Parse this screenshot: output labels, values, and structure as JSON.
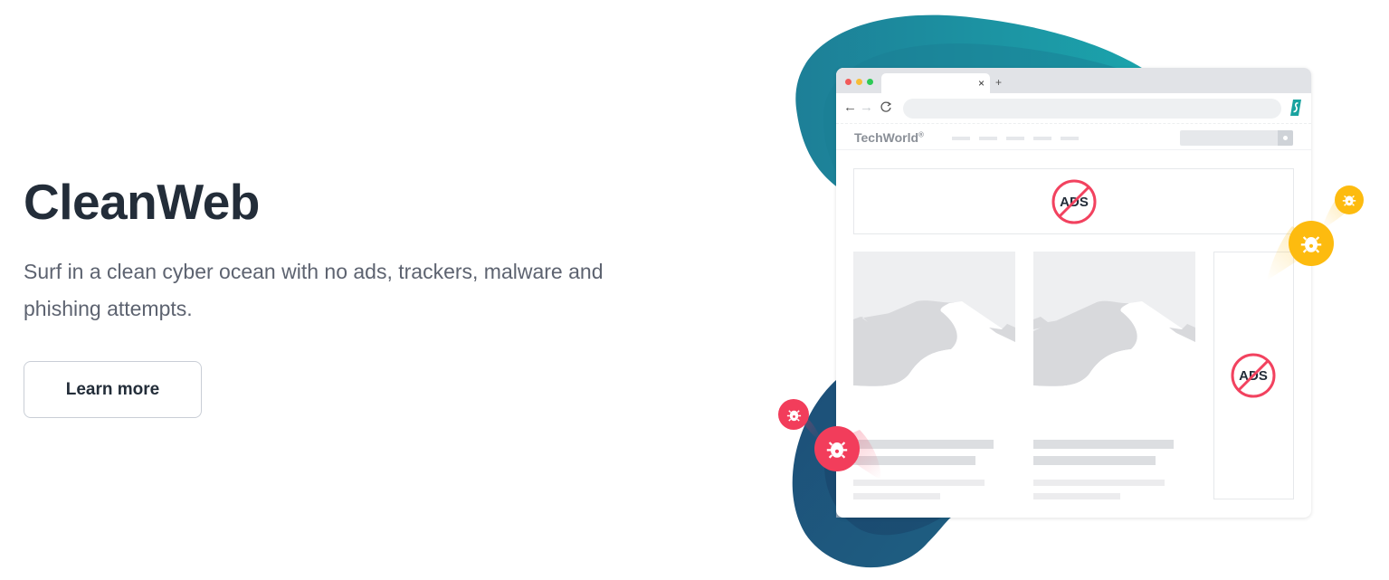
{
  "hero": {
    "title": "CleanWeb",
    "description": "Surf in a clean cyber ocean with no ads, trackers, malware and phishing attempts.",
    "cta_label": "Learn more"
  },
  "illustration": {
    "browser": {
      "tab_close_glyph": "×",
      "new_tab_glyph": "+",
      "nav": {
        "back_glyph": "←",
        "forward_glyph": "→",
        "reload_glyph": "C"
      },
      "site_logo": "TechWorld",
      "site_logo_mark": "®",
      "ad_label": "ADS"
    },
    "icons": {
      "brand": "surfshark-s-icon",
      "blocked": "no-ads-icon",
      "threat": "bug-icon"
    },
    "colors": {
      "accent_teal": "#1a9faa",
      "blob_dark": "#1c4a72",
      "block_red": "#f2425f",
      "tracker_yellow": "#fdbb0f",
      "malware_red": "#f23d5b",
      "text_dark": "#232d39",
      "text_muted": "#5d6370"
    }
  }
}
